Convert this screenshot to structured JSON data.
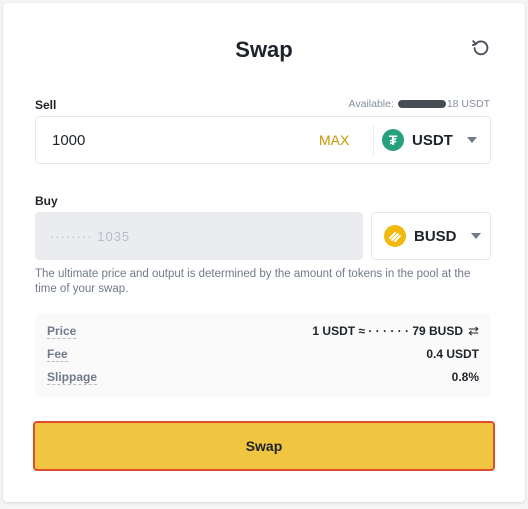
{
  "header": {
    "title": "Swap",
    "refresh_icon": "refresh-icon"
  },
  "sell": {
    "label": "Sell",
    "available_prefix": "Available: ",
    "available_suffix": "18 USDT",
    "amount": "1000",
    "max_label": "MAX",
    "token": "USDT",
    "token_glyph": "₮",
    "token_color": "#26a17b"
  },
  "buy": {
    "label": "Buy",
    "amount_masked": "········ 1035",
    "token": "BUSD",
    "token_color": "#f0b90b"
  },
  "note": "The ultimate price and output is determined by the amount of tokens in the pool at the time of your swap.",
  "details": {
    "price_label": "Price",
    "price_value": "1 USDT ≈ · · · · · · 79 BUSD",
    "fee_label": "Fee",
    "fee_value": "0.4 USDT",
    "slippage_label": "Slippage",
    "slippage_value": "0.8%"
  },
  "actions": {
    "swap_label": "Swap"
  },
  "colors": {
    "accent": "#f0c53f",
    "highlight_border": "#e24c2c"
  }
}
